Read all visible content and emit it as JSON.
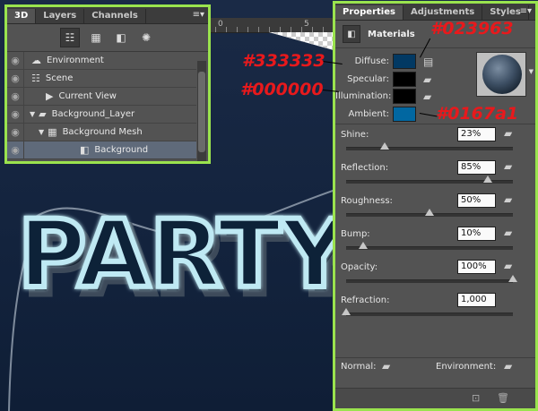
{
  "panel3d": {
    "tabs": [
      "3D",
      "Layers",
      "Channels"
    ],
    "menu_icon": "panel-menu-icon",
    "tools": [
      "scene-filter-icon",
      "mesh-filter-icon",
      "material-filter-icon",
      "light-filter-icon"
    ],
    "items": [
      {
        "label": "Environment",
        "icon": "environment-icon",
        "indent": 0,
        "expand": ""
      },
      {
        "label": "Scene",
        "icon": "scene-icon",
        "indent": 0,
        "expand": ""
      },
      {
        "label": "Current View",
        "icon": "camera-icon",
        "indent": 1,
        "expand": ""
      },
      {
        "label": "Background_Layer",
        "icon": "folder-icon",
        "indent": 0,
        "expand": "▼"
      },
      {
        "label": "Background Mesh",
        "icon": "mesh-icon",
        "indent": 1,
        "expand": "▼"
      },
      {
        "label": "Background",
        "icon": "material-icon",
        "indent": 3,
        "expand": "",
        "selected": true
      }
    ]
  },
  "properties": {
    "tabs": [
      "Properties",
      "Adjustments",
      "Styles"
    ],
    "section_title": "Materials",
    "colors": [
      {
        "label": "Diffuse:",
        "swatch": "#023963"
      },
      {
        "label": "Specular:",
        "swatch": "#333333"
      },
      {
        "label": "Illumination:",
        "swatch": "#000000"
      },
      {
        "label": "Ambient:",
        "swatch": "#0167a1"
      }
    ],
    "sliders": [
      {
        "label": "Shine:",
        "value": "23%",
        "position": 0.23
      },
      {
        "label": "Reflection:",
        "value": "85%",
        "position": 0.85
      },
      {
        "label": "Roughness:",
        "value": "50%",
        "position": 0.5
      },
      {
        "label": "Bump:",
        "value": "10%",
        "position": 0.1
      },
      {
        "label": "Opacity:",
        "value": "100%",
        "position": 1.0
      },
      {
        "label": "Refraction:",
        "value": "1,000",
        "position": 0.0
      }
    ],
    "normal_label": "Normal:",
    "environment_label": "Environment:"
  },
  "annotations": {
    "diffuse": "#023963",
    "specular": "#333333",
    "illumination": "#000000",
    "ambient": "#0167a1"
  },
  "canvas": {
    "ruler_numbers": [
      "0",
      "5"
    ],
    "neon_text": "PARTY"
  }
}
